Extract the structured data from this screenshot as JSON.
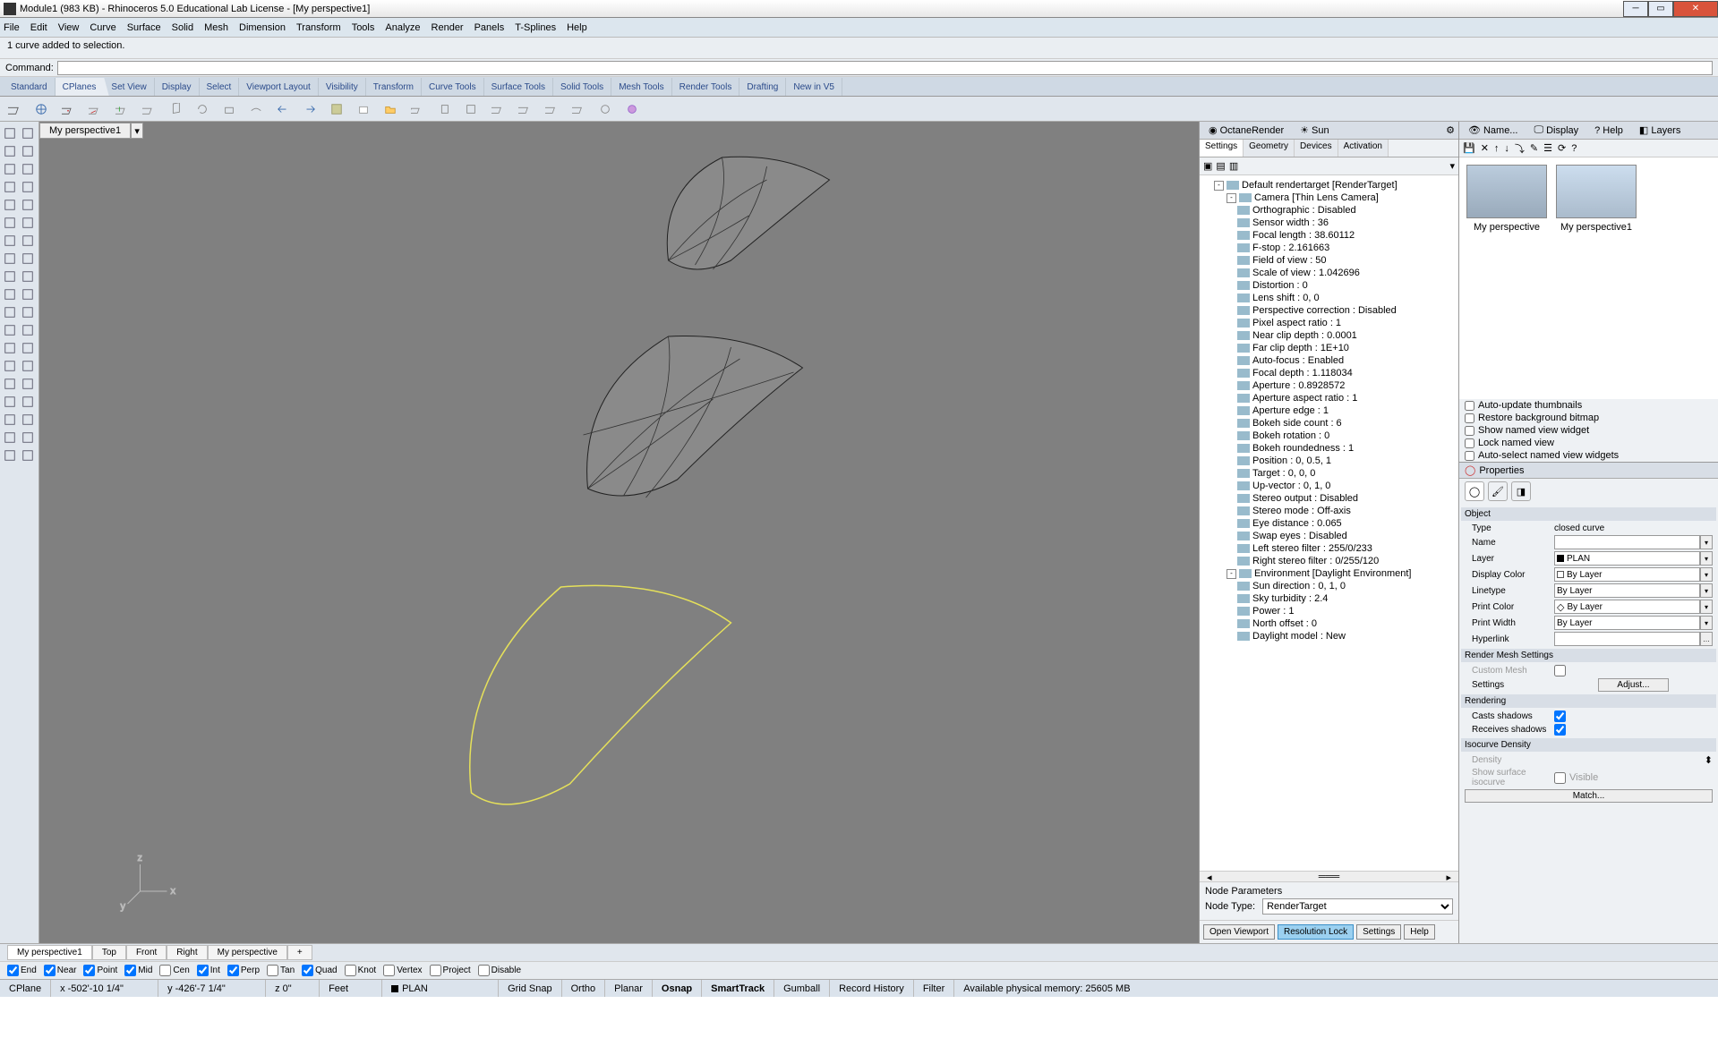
{
  "title": "Module1 (983 KB) - Rhinoceros 5.0 Educational Lab License - [My perspective1]",
  "menu": [
    "File",
    "Edit",
    "View",
    "Curve",
    "Surface",
    "Solid",
    "Mesh",
    "Dimension",
    "Transform",
    "Tools",
    "Analyze",
    "Render",
    "Panels",
    "T-Splines",
    "Help"
  ],
  "cmd_hist": "1 curve added to selection.",
  "cmd_label": "Command:",
  "cmd_value": "",
  "toolTabs": [
    "Standard",
    "CPlanes",
    "Set View",
    "Display",
    "Select",
    "Viewport Layout",
    "Visibility",
    "Transform",
    "Curve Tools",
    "Surface Tools",
    "Solid Tools",
    "Mesh Tools",
    "Render Tools",
    "Drafting",
    "New in V5"
  ],
  "activeToolTab": 1,
  "viewportTab": "My perspective1",
  "octane": {
    "hdr": [
      {
        "label": "OctaneRender",
        "icon": "octane"
      },
      {
        "label": "Sun",
        "icon": "sun"
      }
    ],
    "subTabs": [
      "Settings",
      "Geometry",
      "Devices",
      "Activation"
    ],
    "tree": [
      {
        "l": 0,
        "exp": "-",
        "txt": "Default rendertarget  [RenderTarget]"
      },
      {
        "l": 1,
        "exp": "-",
        "txt": "Camera  [Thin Lens Camera]"
      },
      {
        "l": 2,
        "txt": "Orthographic : Disabled"
      },
      {
        "l": 2,
        "txt": "Sensor width : 36"
      },
      {
        "l": 2,
        "txt": "Focal length : 38.60112"
      },
      {
        "l": 2,
        "txt": "F-stop : 2.161663"
      },
      {
        "l": 2,
        "txt": "Field of view : 50"
      },
      {
        "l": 2,
        "txt": "Scale of view : 1.042696"
      },
      {
        "l": 2,
        "txt": "Distortion : 0"
      },
      {
        "l": 2,
        "txt": "Lens shift : 0, 0"
      },
      {
        "l": 2,
        "txt": "Perspective correction : Disabled"
      },
      {
        "l": 2,
        "txt": "Pixel aspect ratio : 1"
      },
      {
        "l": 2,
        "txt": "Near clip depth : 0.0001"
      },
      {
        "l": 2,
        "txt": "Far clip depth : 1E+10"
      },
      {
        "l": 2,
        "txt": "Auto-focus : Enabled"
      },
      {
        "l": 2,
        "txt": "Focal depth : 1.118034"
      },
      {
        "l": 2,
        "txt": "Aperture : 0.8928572"
      },
      {
        "l": 2,
        "txt": "Aperture aspect ratio : 1"
      },
      {
        "l": 2,
        "txt": "Aperture edge : 1"
      },
      {
        "l": 2,
        "txt": "Bokeh side count : 6"
      },
      {
        "l": 2,
        "txt": "Bokeh rotation : 0"
      },
      {
        "l": 2,
        "txt": "Bokeh roundedness : 1"
      },
      {
        "l": 2,
        "txt": "Position : 0, 0.5, 1"
      },
      {
        "l": 2,
        "txt": "Target : 0, 0, 0"
      },
      {
        "l": 2,
        "txt": "Up-vector : 0, 1, 0"
      },
      {
        "l": 2,
        "txt": "Stereo output : Disabled"
      },
      {
        "l": 2,
        "txt": "Stereo mode : Off-axis"
      },
      {
        "l": 2,
        "txt": "Eye distance : 0.065"
      },
      {
        "l": 2,
        "txt": "Swap eyes : Disabled"
      },
      {
        "l": 2,
        "txt": "Left stereo filter : 255/0/233"
      },
      {
        "l": 2,
        "txt": "Right stereo filter : 0/255/120"
      },
      {
        "l": 1,
        "exp": "-",
        "txt": "Environment  [Daylight Environment]"
      },
      {
        "l": 2,
        "txt": "Sun direction : 0, 1, 0"
      },
      {
        "l": 2,
        "txt": "Sky turbidity : 2.4"
      },
      {
        "l": 2,
        "txt": "Power : 1"
      },
      {
        "l": 2,
        "txt": "North offset : 0"
      },
      {
        "l": 2,
        "txt": "Daylight model : New"
      }
    ],
    "nodeParamLabel": "Node Parameters",
    "nodeTypeLabel": "Node Type:",
    "nodeType": "RenderTarget",
    "btns": [
      "Open Viewport",
      "Resolution Lock",
      "Settings",
      "Help"
    ]
  },
  "named": {
    "hdrTabs": [
      {
        "l": "Name...",
        "i": "eye"
      },
      {
        "l": "Display",
        "i": "display"
      },
      {
        "l": "Help",
        "i": "help"
      },
      {
        "l": "Layers",
        "i": "layers"
      }
    ],
    "thumbs": [
      {
        "label": "My perspective"
      },
      {
        "label": "My perspective1"
      }
    ],
    "checks": [
      "Auto-update thumbnails",
      "Restore background bitmap",
      "Show named view widget",
      "Lock named view",
      "Auto-select named view widgets"
    ]
  },
  "props": {
    "title": "Properties",
    "sectObj": "Object",
    "rows": [
      {
        "lbl": "Type",
        "val": "closed curve",
        "plain": true
      },
      {
        "lbl": "Name",
        "val": ""
      },
      {
        "lbl": "Layer",
        "val": "PLAN",
        "sw": "#000"
      },
      {
        "lbl": "Display Color",
        "val": "By Layer",
        "box": true
      },
      {
        "lbl": "Linetype",
        "val": "By Layer"
      },
      {
        "lbl": "Print Color",
        "val": "By Layer",
        "dia": true
      },
      {
        "lbl": "Print Width",
        "val": "By Layer"
      },
      {
        "lbl": "Hyperlink",
        "val": "",
        "dots": true
      }
    ],
    "sectMesh": "Render Mesh Settings",
    "customMesh": "Custom Mesh",
    "settings": "Settings",
    "adjust": "Adjust...",
    "sectRend": "Rendering",
    "casts": "Casts shadows",
    "recv": "Receives shadows",
    "sectIso": "Isocurve Density",
    "density": "Density",
    "showIso": "Show surface isocurve",
    "visible": "Visible",
    "match": "Match..."
  },
  "bottomTabs": [
    "My perspective1",
    "Top",
    "Front",
    "Right",
    "My perspective"
  ],
  "osnaps": [
    {
      "l": "End",
      "c": true
    },
    {
      "l": "Near",
      "c": true
    },
    {
      "l": "Point",
      "c": true
    },
    {
      "l": "Mid",
      "c": true
    },
    {
      "l": "Cen",
      "c": false
    },
    {
      "l": "Int",
      "c": true
    },
    {
      "l": "Perp",
      "c": true
    },
    {
      "l": "Tan",
      "c": false
    },
    {
      "l": "Quad",
      "c": true
    },
    {
      "l": "Knot",
      "c": false
    },
    {
      "l": "Vertex",
      "c": false
    },
    {
      "l": "Project",
      "c": false
    },
    {
      "l": "Disable",
      "c": false
    }
  ],
  "status": {
    "cplane": "CPlane",
    "x": "x -502'-10 1/4\"",
    "y": "y -426'-7 1/4\"",
    "z": "z 0\"",
    "units": "Feet",
    "layer": "PLAN",
    "cells": [
      "Grid Snap",
      "Ortho",
      "Planar",
      "Osnap",
      "SmartTrack",
      "Gumball",
      "Record History",
      "Filter"
    ],
    "mem": "Available physical memory: 25605 MB"
  }
}
